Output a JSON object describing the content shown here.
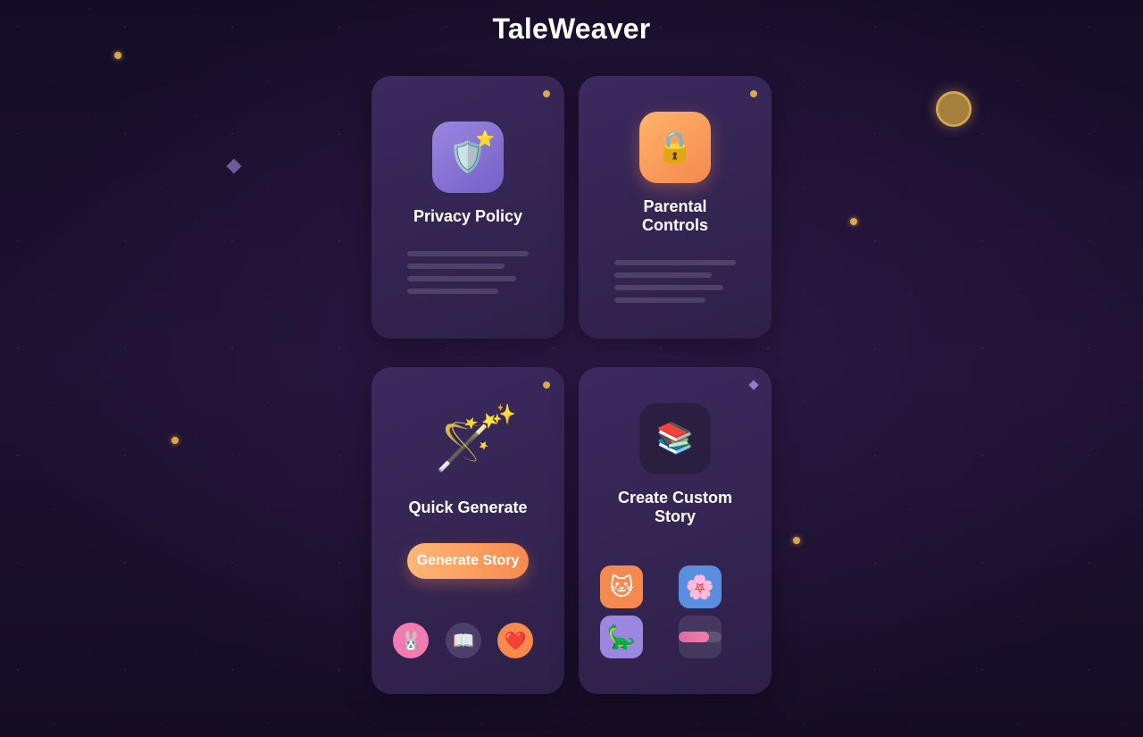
{
  "app": {
    "title": "TaleWeaver"
  },
  "colors": {
    "accent_orange": "#f6894e",
    "accent_purple": "#7460c8",
    "gold": "#d9a84e",
    "card_bg": "#3b2a5e",
    "page_bg": "#1d1232"
  },
  "decor": {
    "moon_icon": "crescent-moon-icon",
    "sparkle_icon": "sparkle-icon"
  },
  "cards": {
    "privacy": {
      "title": "Privacy Policy",
      "icon": "shield-icon",
      "icon_glyph": "🛡️",
      "badge_glyph": "⭐"
    },
    "parental": {
      "title": "Parental Controls",
      "icon": "lock-icon",
      "icon_glyph": "🔒"
    },
    "quick": {
      "title": "Quick Generate",
      "icon": "magic-wand-icon",
      "icon_glyph": "🪄",
      "sparkles_glyph": "✨",
      "button_label": "Generate Story",
      "bottom_icons": [
        {
          "name": "bunny-icon",
          "glyph": "🐰",
          "color": "#f27bb0"
        },
        {
          "name": "book-icon",
          "glyph": "📖",
          "color": "#4c3f6b"
        },
        {
          "name": "heart-icon",
          "glyph": "❤️",
          "color": "#f6894e"
        }
      ]
    },
    "custom": {
      "title": "Create Custom Story",
      "icon": "books-icon",
      "icon_glyph": "📚",
      "tiles": [
        {
          "name": "cat-icon",
          "glyph": "🐱",
          "color": "#f6894e"
        },
        {
          "name": "flower-icon",
          "glyph": "🌸",
          "color": "#5a8fe0"
        },
        {
          "name": "dinosaur-icon",
          "glyph": "🦕",
          "color": "#9b87e0"
        }
      ],
      "progress": 0.7
    }
  }
}
